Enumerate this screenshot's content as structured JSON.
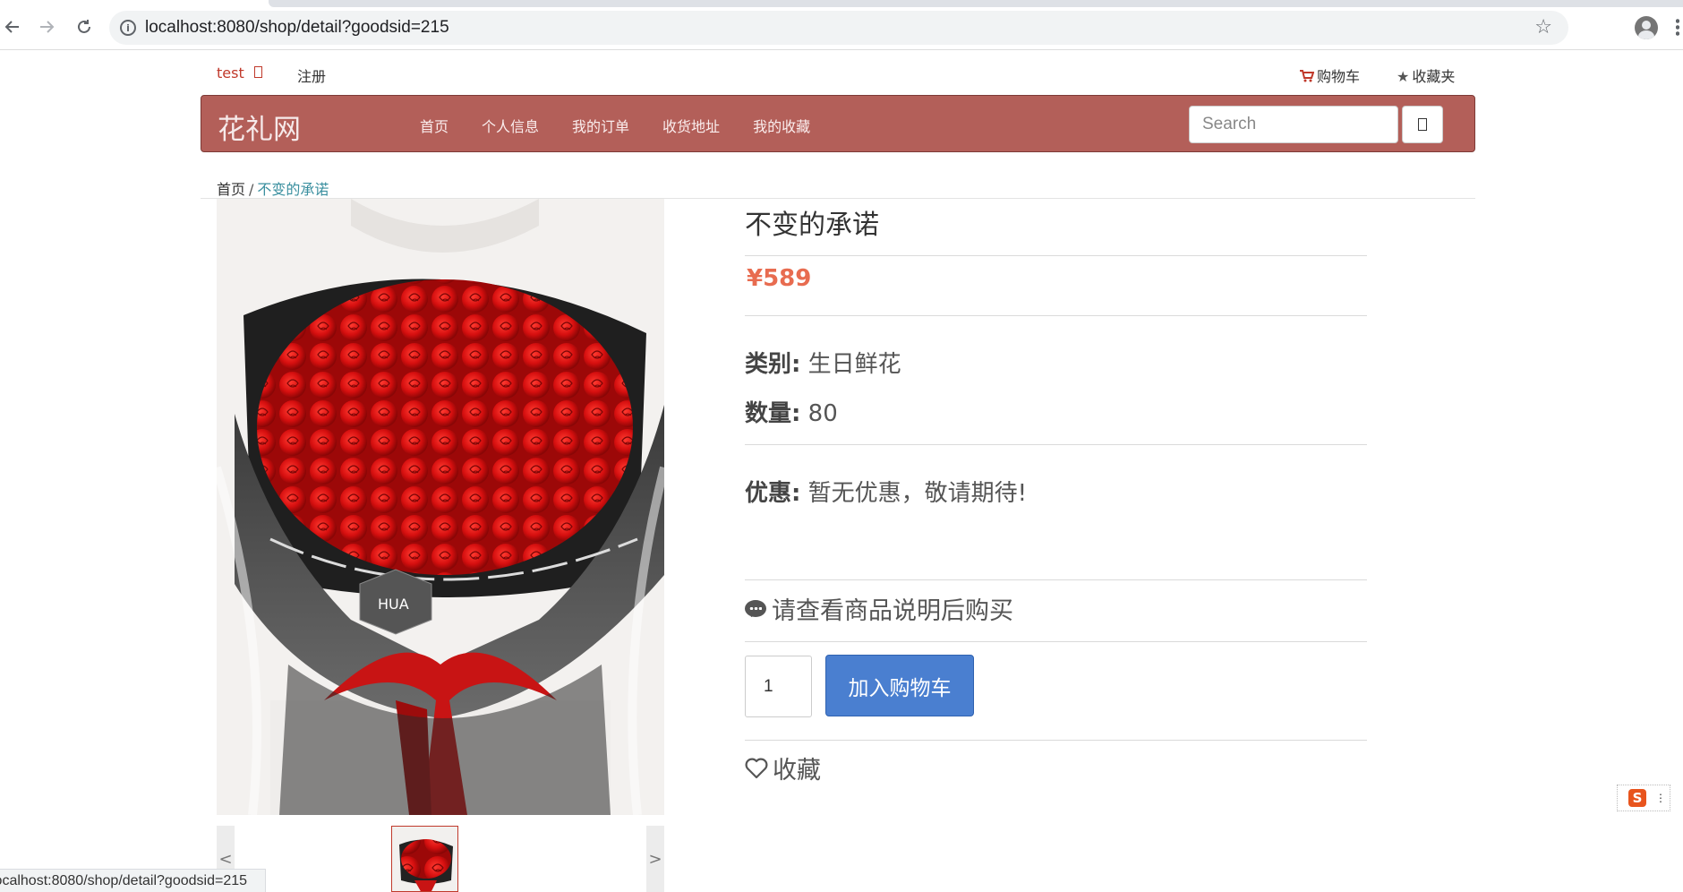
{
  "browser": {
    "url": "localhost:8080/shop/detail?goodsid=215",
    "back_icon": "arrow-left-icon",
    "forward_icon": "arrow-right-icon",
    "reload_icon": "reload-icon",
    "status_text": "localhost:8080/shop/detail?goodsid=215"
  },
  "toplinks": {
    "user": "test",
    "register": "注册",
    "cart": "购物车",
    "favorites": "收藏夹"
  },
  "navbar": {
    "brand": "花礼网",
    "items": [
      {
        "label": "首页"
      },
      {
        "label": "个人信息"
      },
      {
        "label": "我的订单"
      },
      {
        "label": "收货地址"
      },
      {
        "label": "我的收藏"
      }
    ],
    "search_placeholder": "Search",
    "bg_color": "#b35f59"
  },
  "breadcrumb": {
    "home": "首页",
    "separator": "/",
    "current": "不变的承诺"
  },
  "product": {
    "title": "不变的承诺",
    "price": "¥589",
    "category_label": "类别:",
    "category_value": "生日鲜花",
    "quantity_label": "数量:",
    "quantity_value": "80",
    "discount_label": "优惠:",
    "discount_value": "暂无优惠，敬请期待!",
    "notice": "请查看商品说明后购买",
    "buy_quantity": "1",
    "add_to_cart": "加入购物车",
    "favorite": "收藏",
    "price_color": "#e86c50",
    "button_color": "#4a7fd0"
  },
  "thumbs": {
    "prev": "<",
    "next": ">"
  },
  "ime": {
    "logo": "S"
  }
}
